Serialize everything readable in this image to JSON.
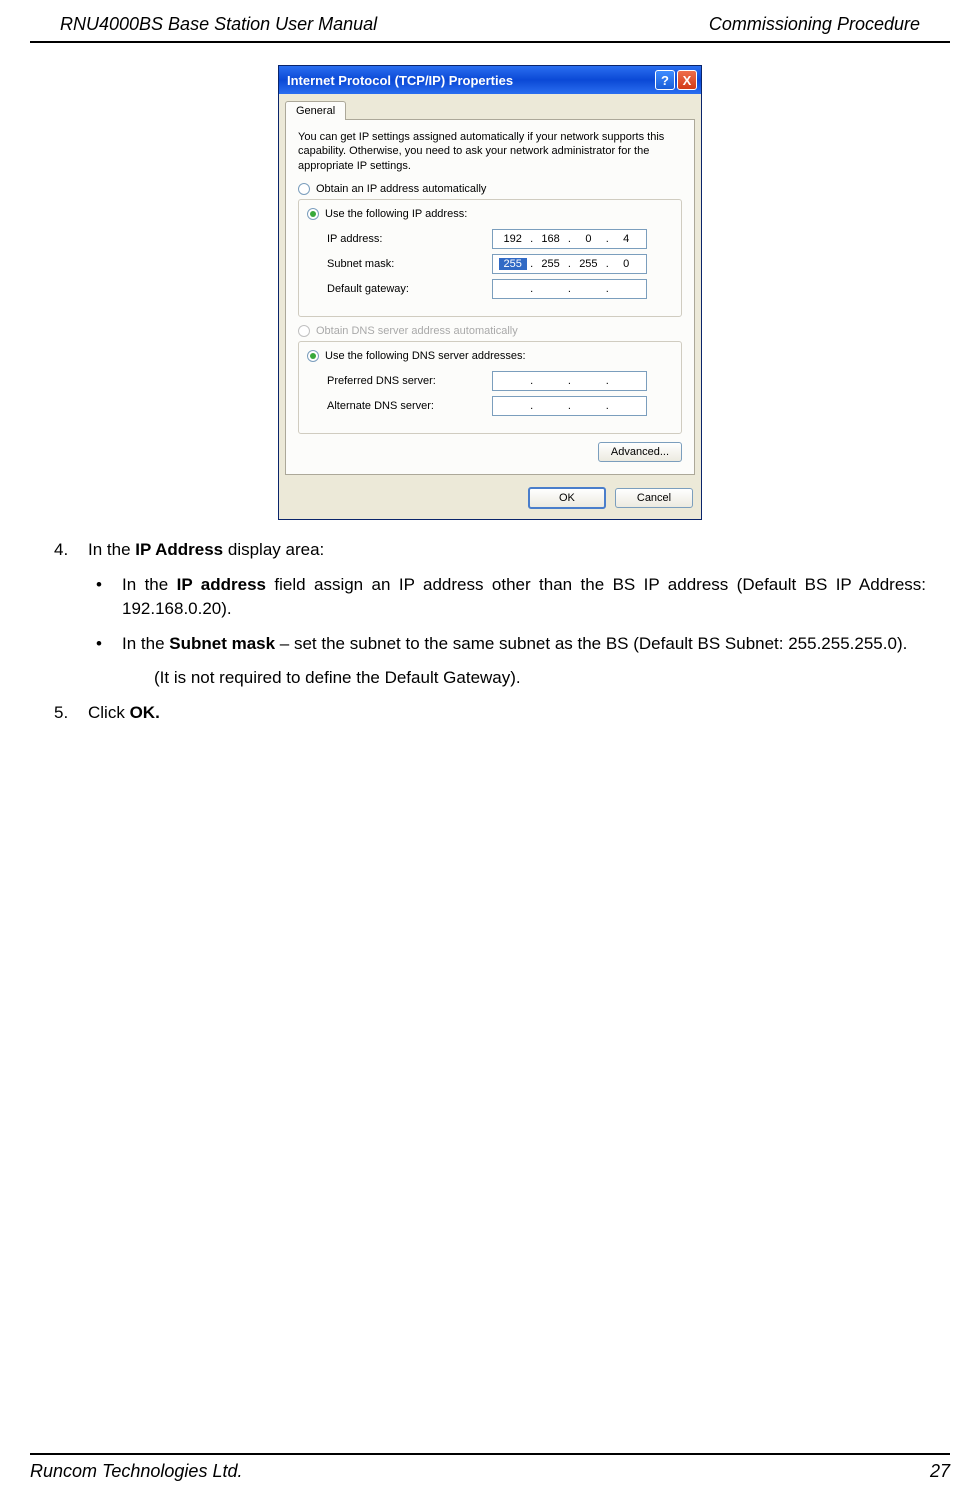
{
  "header": {
    "left": "RNU4000BS Base Station User Manual",
    "right": "Commissioning Procedure"
  },
  "footer": {
    "left": "Runcom Technologies Ltd.",
    "right": "27"
  },
  "dialog": {
    "title": "Internet Protocol (TCP/IP) Properties",
    "help_glyph": "?",
    "close_glyph": "X",
    "tab": "General",
    "intro": "You can get IP settings assigned automatically if your network supports this capability. Otherwise, you need to ask your network administrator for the appropriate IP settings.",
    "ip_section": {
      "radio_auto": "Obtain an IP address automatically",
      "radio_manual": "Use the following IP address:",
      "ip_label": "IP address:",
      "ip_value": {
        "o1": "192",
        "o2": "168",
        "o3": "0",
        "o4": "4"
      },
      "subnet_label": "Subnet mask:",
      "subnet_value": {
        "o1": "255",
        "o2": "255",
        "o3": "255",
        "o4": "0"
      },
      "gateway_label": "Default gateway:"
    },
    "dns_section": {
      "radio_auto": "Obtain DNS server address automatically",
      "radio_manual": "Use the following DNS server addresses:",
      "preferred_label": "Preferred DNS server:",
      "alternate_label": "Alternate DNS server:"
    },
    "advanced_button": "Advanced...",
    "ok_button": "OK",
    "cancel_button": "Cancel"
  },
  "doc": {
    "item4_num": "4.",
    "item4_lead": "In the ",
    "item4_bold": "IP Address",
    "item4_rest": " display area:",
    "bullet1_a": "In the ",
    "bullet1_bold": "IP address",
    "bullet1_b": " field assign an IP address other than the BS IP address (Default BS IP Address: 192.168.0.20).",
    "bullet2_a": "In the ",
    "bullet2_bold": "Subnet mask",
    "bullet2_b": " – set the subnet to the same subnet as the BS (Default BS Subnet: 255.255.255.0).",
    "note": "(It is not required to define the Default Gateway).",
    "item5_num": "5.",
    "item5_a": "Click ",
    "item5_bold": "OK.",
    "bullet_glyph": "•"
  }
}
